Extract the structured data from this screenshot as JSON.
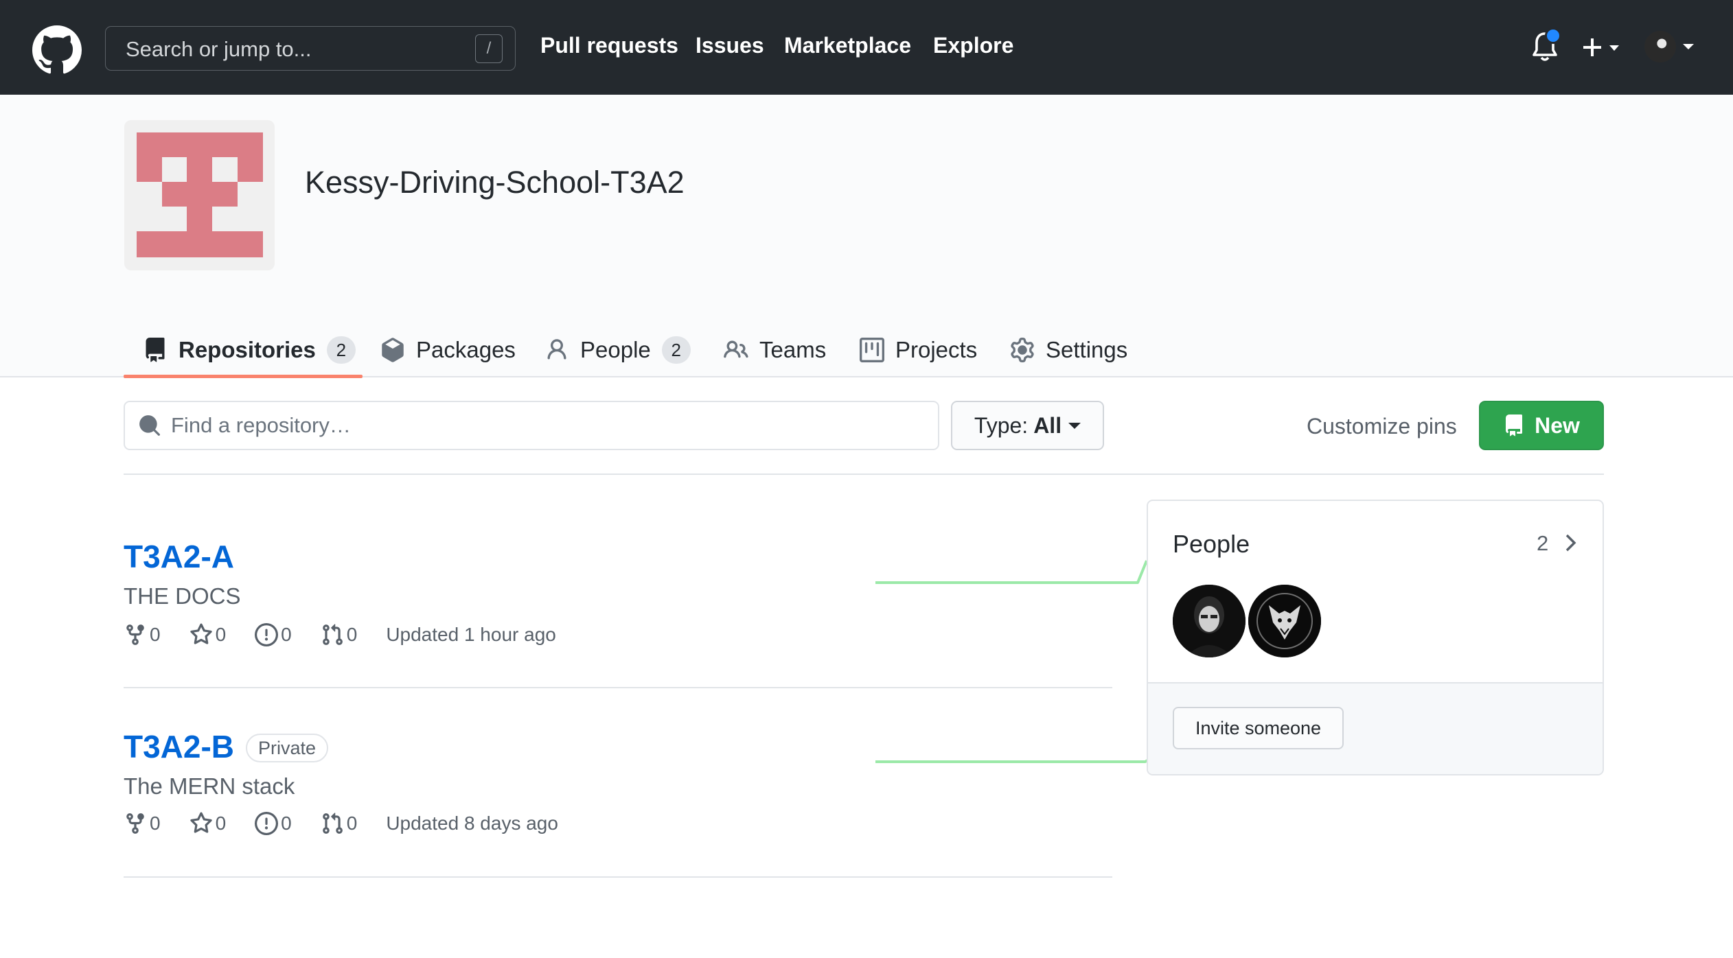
{
  "header": {
    "search_placeholder": "Search or jump to...",
    "search_key": "/",
    "nav": [
      "Pull requests",
      "Issues",
      "Marketplace",
      "Explore"
    ],
    "icons": [
      "github-logo-icon",
      "bell-icon",
      "plus-icon",
      "avatar"
    ]
  },
  "org": {
    "name": "Kessy-Driving-School-T3A2",
    "avatar_color": "#db7d86"
  },
  "tabs": [
    {
      "label": "Repositories",
      "count": "2",
      "icon": "repo-icon",
      "selected": true
    },
    {
      "label": "Packages",
      "icon": "package-icon"
    },
    {
      "label": "People",
      "count": "2",
      "icon": "person-icon"
    },
    {
      "label": "Teams",
      "icon": "people-icon"
    },
    {
      "label": "Projects",
      "icon": "project-icon"
    },
    {
      "label": "Settings",
      "icon": "gear-icon"
    }
  ],
  "filter": {
    "find_placeholder": "Find a repository…",
    "type_label": "Type:",
    "type_value": "All",
    "customize_pins": "Customize pins",
    "new_label": "New"
  },
  "repos": [
    {
      "name": "T3A2-A",
      "description": "THE DOCS",
      "forks": "0",
      "stars": "0",
      "issues": "0",
      "pulls": "0",
      "updated": "Updated 1 hour ago"
    },
    {
      "name": "T3A2-B",
      "badge": "Private",
      "description": "The MERN stack",
      "forks": "0",
      "stars": "0",
      "issues": "0",
      "pulls": "0",
      "updated": "Updated 8 days ago"
    }
  ],
  "people": {
    "title": "People",
    "count": "2",
    "invite_label": "Invite someone"
  },
  "colors": {
    "header_bg": "#24292e",
    "link": "#0366d6",
    "new_button": "#2ea44f",
    "tab_underline": "#f9826c",
    "sparkline": "#9be9a8"
  }
}
